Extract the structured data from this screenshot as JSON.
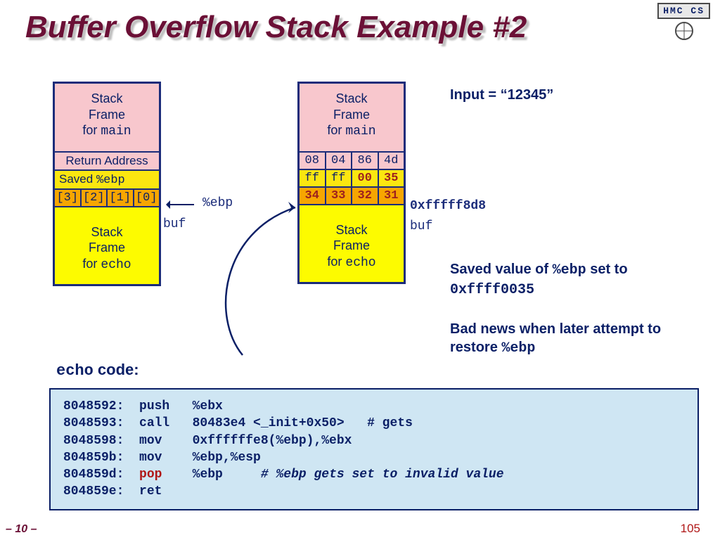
{
  "title": "Buffer Overflow Stack Example #2",
  "logo": {
    "text": "HMC CS"
  },
  "stack_left": {
    "header_prefix": "Stack\nFrame\nfor ",
    "header_code": "main",
    "return_address": "Return Address",
    "saved_label": "Saved ",
    "saved_reg": "%ebp",
    "buf_cells": [
      "[3]",
      "[2]",
      "[1]",
      "[0]"
    ],
    "footer_prefix": "Stack\nFrame\nfor ",
    "footer_code": "echo",
    "ptr_reg": "%ebp",
    "ptr_buf": "buf"
  },
  "stack_right": {
    "header_prefix": "Stack\nFrame\nfor ",
    "header_code": "main",
    "row_return": [
      "08",
      "04",
      "86",
      "4d"
    ],
    "row_saved": [
      "ff",
      "ff",
      "00",
      "35"
    ],
    "row_buf": [
      "34",
      "33",
      "32",
      "31"
    ],
    "footer_prefix": "Stack\nFrame\nfor ",
    "footer_code": "echo",
    "saved_value_hex": "0xfffff8d8",
    "buf_label": "buf"
  },
  "annotations": {
    "input_line": "Input = “12345”",
    "saved_line_1": "Saved value of ",
    "saved_reg": "%ebp",
    "saved_line_2": " set to ",
    "saved_hex": "0xffff0035",
    "bad_news": "Bad news when later attempt to restore  ",
    "bad_reg": "%ebp"
  },
  "code": {
    "caption_code": "echo",
    "caption_word": " code:",
    "l1": "8048592:  push   %ebx",
    "l2": "8048593:  call   80483e4 <_init+0x50>   # gets",
    "l3": "8048598:  mov    0xffffffe8(%ebp),%ebx",
    "l4": "804859b:  mov    %ebp,%esp",
    "l5a": "804859d:  ",
    "l5_op": "pop",
    "l5b": "    %ebp     ",
    "l5_cmt": "# %ebp gets set to invalid value",
    "l6": "804859e:  ret"
  },
  "page_left": "– 10 –",
  "page_right": "105"
}
